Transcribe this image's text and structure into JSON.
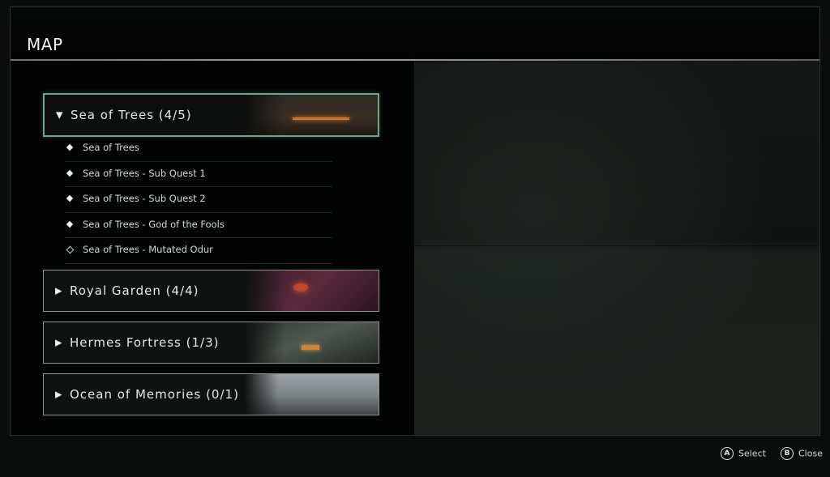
{
  "title": "MAP",
  "regions": [
    {
      "label": "Sea of Trees (4/5)",
      "expanded": true
    },
    {
      "label": "Royal Garden (4/4)",
      "expanded": false
    },
    {
      "label": "Hermes Fortress (1/3)",
      "expanded": false
    },
    {
      "label": "Ocean of Memories (0/1)",
      "expanded": false
    }
  ],
  "sub_items": [
    {
      "label": "Sea of Trees",
      "completed": true
    },
    {
      "label": "Sea of Trees - Sub Quest 1",
      "completed": true
    },
    {
      "label": "Sea of Trees - Sub Quest 2",
      "completed": true
    },
    {
      "label": "Sea of Trees - God of the Fools",
      "completed": true
    },
    {
      "label": "Sea of Trees - Mutated Odur",
      "completed": false
    }
  ],
  "footer": {
    "select_key": "A",
    "select_label": "Select",
    "close_key": "B",
    "close_label": "Close"
  },
  "colors": {
    "active_border": "#6fa58a",
    "fire_accent": "#d6722b"
  },
  "icons": {
    "expanded": "chevron-down-icon",
    "collapsed": "chevron-right-icon",
    "completed": "filled-diamond-icon",
    "incomplete": "hollow-diamond-icon"
  }
}
